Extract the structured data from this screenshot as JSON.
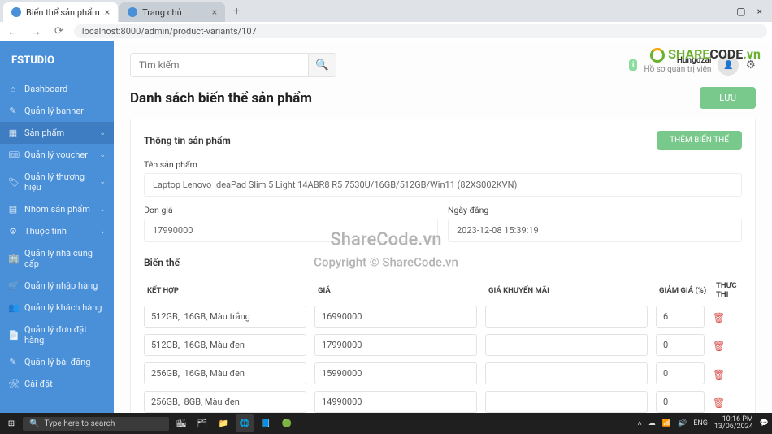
{
  "browser": {
    "tabs": [
      {
        "label": "Biến thể sản phẩm"
      },
      {
        "label": "Trang chủ"
      }
    ],
    "url": "localhost:8000/admin/product-variants/107"
  },
  "watermark": {
    "share": "SHARE",
    "code": "CODE",
    "tld": ".vn",
    "mid_line1": "ShareCode.vn",
    "mid_line2": "Copyright © ShareCode.vn"
  },
  "brand": "FSTUDIO",
  "sidebar": {
    "items": [
      {
        "icon": "⌂",
        "label": "Dashboard"
      },
      {
        "icon": "✎",
        "label": "Quản lý banner"
      },
      {
        "icon": "▦",
        "label": "Sản phẩm",
        "chev": true,
        "active": true
      },
      {
        "icon": "🎟",
        "label": "Quản lý voucher",
        "chev": true
      },
      {
        "icon": "🏷",
        "label": "Quản lý thương hiệu",
        "chev": true
      },
      {
        "icon": "▤",
        "label": "Nhóm sản phẩm",
        "chev": true
      },
      {
        "icon": "⚙",
        "label": "Thuộc tính",
        "chev": true
      },
      {
        "icon": "🏢",
        "label": "Quản lý nhà cung cấp"
      },
      {
        "icon": "🛒",
        "label": "Quản lý nhập hàng"
      },
      {
        "icon": "👥",
        "label": "Quản lý khách hàng"
      },
      {
        "icon": "📄",
        "label": "Quản lý đơn đặt hàng"
      },
      {
        "icon": "✎",
        "label": "Quản lý bài đăng"
      },
      {
        "icon": "🛠",
        "label": "Cài đặt"
      }
    ]
  },
  "topbar": {
    "search_placeholder": "Tìm kiếm",
    "badge": "i",
    "user_name": "Hungdzai",
    "user_role": "Hồ sơ quản trị viên"
  },
  "page": {
    "title": "Danh sách biến thể sản phẩm",
    "save_label": "LƯU"
  },
  "info_card": {
    "title": "Thông tin sản phẩm",
    "add_label": "THÊM BIẾN THỂ",
    "name_label": "Tên sản phẩm",
    "name_value": "Laptop Lenovo IdeaPad Slim 5 Light 14ABR8 R5 7530U/16GB/512GB/Win11 (82XS002KVN)",
    "price_label": "Đơn giá",
    "price_value": "17990000",
    "date_label": "Ngày đăng",
    "date_value": "2023-12-08 15:39:19"
  },
  "variants": {
    "section_title": "Biến thể",
    "headers": {
      "combo": "KẾT HỢP",
      "price": "GIÁ",
      "promo": "GIÁ KHUYẾN MÃI",
      "discount": "GIẢM GIÁ (%)",
      "action": "THỰC THI"
    },
    "rows": [
      {
        "combo": "512GB,  16GB, Màu trắng",
        "price": "16990000",
        "promo": "",
        "discount": "6"
      },
      {
        "combo": "512GB,  16GB, Màu đen",
        "price": "17990000",
        "promo": "",
        "discount": "0"
      },
      {
        "combo": "256GB,  16GB, Màu đen",
        "price": "15990000",
        "promo": "",
        "discount": "0"
      },
      {
        "combo": "256GB,  8GB, Màu đen",
        "price": "14990000",
        "promo": "",
        "discount": "0"
      }
    ]
  },
  "taskbar": {
    "search_placeholder": "Type here to search",
    "time": "10:16 PM",
    "date": "13/06/2024"
  }
}
